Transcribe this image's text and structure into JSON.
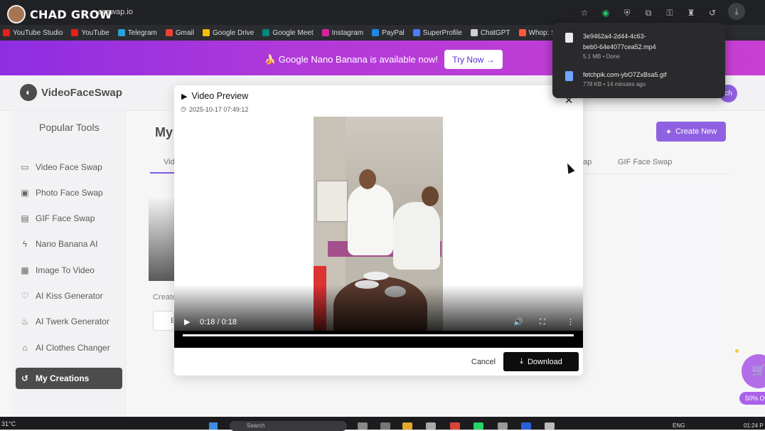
{
  "browser": {
    "channel_name": "CHAD GROW",
    "url_fragment": "ceswap.io",
    "bookmarks": [
      {
        "label": "YouTube Studio",
        "color": "#e62117"
      },
      {
        "label": "YouTube",
        "color": "#e62117"
      },
      {
        "label": "Telegram",
        "color": "#2aa1da"
      },
      {
        "label": "Gmail",
        "color": "#ea4335"
      },
      {
        "label": "Google Drive",
        "color": "#fbbc04"
      },
      {
        "label": "Google Meet",
        "color": "#00897b"
      },
      {
        "label": "Instagram",
        "color": "#d6249f"
      },
      {
        "label": "PayPal",
        "color": "#1e88e5"
      },
      {
        "label": "SuperProfile",
        "color": "#4a7cff"
      },
      {
        "label": "ChatGPT",
        "color": "#cfcfcf"
      },
      {
        "label": "Whop: Start a",
        "color": "#ff5a3c"
      }
    ],
    "toolbar_icons": [
      "star-icon",
      "extension-green-icon",
      "shield-icon",
      "puzzle-icon",
      "key-icon",
      "incognito-icon",
      "history-icon",
      "download-icon"
    ]
  },
  "banner": {
    "text": "🍌 Google Nano Banana is available now!",
    "cta": "Try Now →"
  },
  "site": {
    "logo_text": "VideoFaceSwap",
    "avatar_text": "ch",
    "create_new": "Create New",
    "page_title": "My",
    "tab_fragment_active": "Vid",
    "tab_fragment_mid": "ap",
    "tab_gif": "GIF Face Swap",
    "created_fragment": "Create",
    "button_fragment": "E",
    "discount": "50% O"
  },
  "sidebar": {
    "title": "Popular Tools",
    "items": [
      {
        "label": "Video Face Swap",
        "icon": "video-icon"
      },
      {
        "label": "Photo Face Swap",
        "icon": "image-icon"
      },
      {
        "label": "GIF Face Swap",
        "icon": "gif-icon"
      },
      {
        "label": "Nano Banana AI",
        "icon": "lightning-icon"
      },
      {
        "label": "Image To Video",
        "icon": "film-icon"
      },
      {
        "label": "AI Kiss Generator",
        "icon": "heart-icon"
      },
      {
        "label": "AI Twerk Generator",
        "icon": "flame-icon"
      },
      {
        "label": "AI Clothes Changer",
        "icon": "shirt-icon"
      },
      {
        "label": "My Creations",
        "icon": "history-icon",
        "active": true
      }
    ]
  },
  "modal": {
    "title": "Video Preview",
    "timestamp": "2025-10-17 07:49:12",
    "time_display": "0:18 / 0:18",
    "progress": 1.0,
    "cancel": "Cancel",
    "download": "Download"
  },
  "downloads": [
    {
      "name_line1": "3e9462a4-2d44-4c63-",
      "name_line2": "beb0-64e4077cea52.mp4",
      "meta": "5.1 MB • Done"
    },
    {
      "name_line1": "fetchpik.com-ybO7ZxBsa5.gif",
      "name_line2": "",
      "meta": "778 KB • 14 minutes ago"
    }
  ],
  "taskbar": {
    "weather": "31°C",
    "search_placeholder": "Search",
    "lang": "ENG",
    "time": "01:24 P"
  },
  "colors": {
    "accent": "#6a2cd9",
    "banner_from": "#8e2de2",
    "banner_to": "#c83fd2",
    "active_nav": "#111111"
  }
}
